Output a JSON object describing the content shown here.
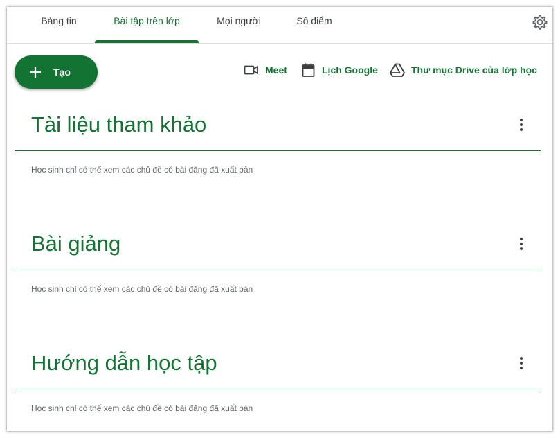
{
  "tabs": [
    {
      "label": "Bảng tin",
      "active": false
    },
    {
      "label": "Bài tập trên lớp",
      "active": true
    },
    {
      "label": "Mọi người",
      "active": false
    },
    {
      "label": "Số điểm",
      "active": false
    }
  ],
  "settings_icon": "gear-icon",
  "create_button": {
    "label": "Tạo",
    "icon": "plus-icon"
  },
  "tools": [
    {
      "label": "Meet",
      "icon": "video-camera-icon"
    },
    {
      "label": "Lịch Google",
      "icon": "calendar-icon"
    },
    {
      "label": "Thư mục Drive của lớp học",
      "icon": "drive-icon"
    }
  ],
  "topics": [
    {
      "title": "Tài liệu tham khảo",
      "note": "Học sinh chỉ có thể xem các chủ đề có bài đăng đã xuất bản"
    },
    {
      "title": "Bài giảng",
      "note": "Học sinh chỉ có thể xem các chủ đề có bài đăng đã xuất bản"
    },
    {
      "title": "Hướng dẫn học tập",
      "note": "Học sinh chỉ có thể xem các chủ đề có bài đăng đã xuất bản"
    }
  ],
  "colors": {
    "accent": "#137333",
    "text": "#3c4043",
    "muted": "#5f6368"
  }
}
